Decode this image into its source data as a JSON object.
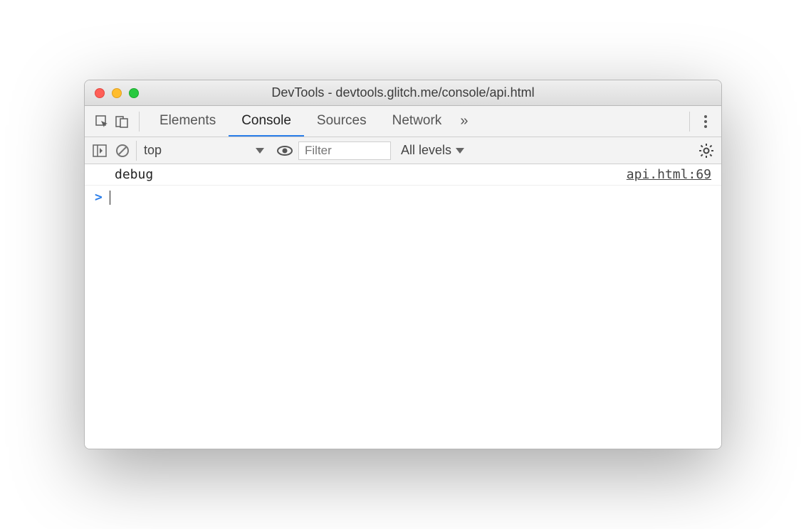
{
  "window": {
    "title": "DevTools - devtools.glitch.me/console/api.html"
  },
  "tabs": {
    "items": [
      "Elements",
      "Console",
      "Sources",
      "Network"
    ],
    "active": "Console",
    "more_icon": "»"
  },
  "toolbar": {
    "context": "top",
    "filter_placeholder": "Filter",
    "filter_value": "",
    "levels": "All levels"
  },
  "console": {
    "rows": [
      {
        "message": "debug",
        "source": "api.html:69"
      }
    ],
    "prompt": ">"
  }
}
